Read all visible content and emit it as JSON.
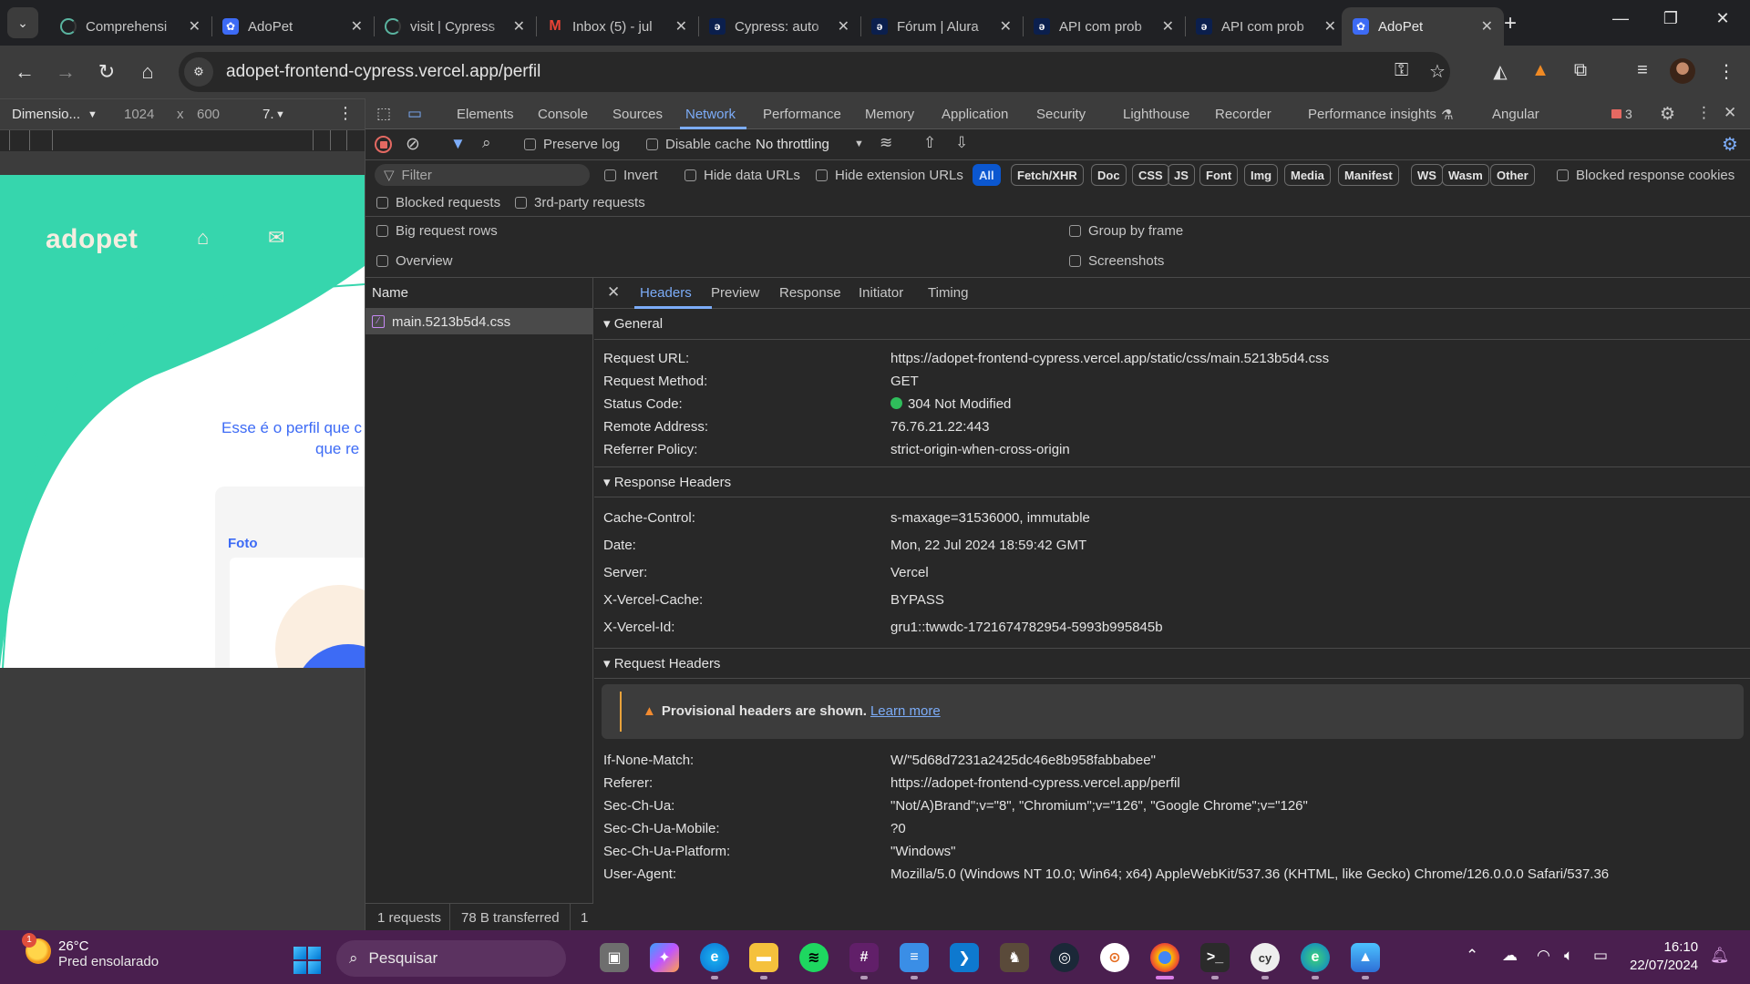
{
  "browser": {
    "tabs": [
      {
        "title": "Comprehensi",
        "favicon": "loading-spinner"
      },
      {
        "title": "AdoPet",
        "favicon": "adopet-paw"
      },
      {
        "title": "visit | Cypress",
        "favicon": "loading-spinner"
      },
      {
        "title": "Inbox (5) - jul",
        "favicon": "gmail"
      },
      {
        "title": "Cypress: auto",
        "favicon": "alura"
      },
      {
        "title": "Fórum | Alura",
        "favicon": "alura"
      },
      {
        "title": "API com prob",
        "favicon": "alura"
      },
      {
        "title": "API com prob",
        "favicon": "alura"
      },
      {
        "title": "AdoPet",
        "favicon": "adopet-paw",
        "active": true
      }
    ],
    "address": "adopet-frontend-cypress.vercel.app/perfil",
    "icons": {
      "back": "←",
      "forward": "→",
      "reload": "↻",
      "home": "⌂",
      "tab_menu": "⌄",
      "new_tab": "+",
      "close_tab": "✕",
      "minimize": "—",
      "restore": "❐",
      "close_window": "✕",
      "site_info": "⚙",
      "password_key": "⚿",
      "bookmark": "☆",
      "extensions": "⧉",
      "media": "≡",
      "menu": "⋮"
    }
  },
  "device_toolbar": {
    "dimensions_label": "Dimensio...",
    "width": "1024",
    "times": "x",
    "height": "600",
    "zoom": "7.",
    "more": "⋮"
  },
  "page": {
    "logo": "adopet",
    "text_line1": "Esse é o perfil que c",
    "text_line2": "que re",
    "foto_label": "Foto",
    "colors": {
      "brand_green": "#36d6ad",
      "brand_blue": "#3d6bf5",
      "cream": "#f5ede0"
    }
  },
  "devtools": {
    "tabs": [
      "Elements",
      "Console",
      "Sources",
      "Network",
      "Performance",
      "Memory",
      "Application",
      "Security",
      "Lighthouse",
      "Recorder",
      "Performance insights",
      "Angular"
    ],
    "active_tab": "Network",
    "issues_count": "3",
    "network_toolbar": {
      "preserve_log": "Preserve log",
      "disable_cache": "Disable cache",
      "throttling": "No throttling"
    },
    "filter": {
      "placeholder": "Filter",
      "invert": "Invert",
      "hide_data_urls": "Hide data URLs",
      "hide_extension_urls": "Hide extension URLs",
      "types": [
        "All",
        "Fetch/XHR",
        "Doc",
        "CSS",
        "JS",
        "Font",
        "Img",
        "Media",
        "Manifest",
        "WS",
        "Wasm",
        "Other"
      ],
      "active_type": "All",
      "blocked_response_cookies": "Blocked response cookies",
      "blocked_requests": "Blocked requests",
      "third_party": "3rd-party requests"
    },
    "settings": {
      "big_request_rows": "Big request rows",
      "overview": "Overview",
      "group_by_frame": "Group by frame",
      "screenshots": "Screenshots"
    },
    "requests": {
      "column": "Name",
      "rows": [
        {
          "name": "main.5213b5d4.css",
          "type": "css"
        }
      ],
      "status_requests": "1 requests",
      "status_transferred": "78 B transferred",
      "status_extra": "1"
    },
    "details": {
      "tabs": [
        "Headers",
        "Preview",
        "Response",
        "Initiator",
        "Timing"
      ],
      "active_tab": "Headers",
      "general": {
        "title": "General",
        "rows": [
          {
            "k": "Request URL:",
            "v": "https://adopet-frontend-cypress.vercel.app/static/css/main.5213b5d4.css"
          },
          {
            "k": "Request Method:",
            "v": "GET"
          },
          {
            "k": "Status Code:",
            "v": "304 Not Modified"
          },
          {
            "k": "Remote Address:",
            "v": "76.76.21.22:443"
          },
          {
            "k": "Referrer Policy:",
            "v": "strict-origin-when-cross-origin"
          }
        ]
      },
      "response_headers": {
        "title": "Response Headers",
        "rows": [
          {
            "k": "Cache-Control:",
            "v": "s-maxage=31536000, immutable"
          },
          {
            "k": "Date:",
            "v": "Mon, 22 Jul 2024 18:59:42 GMT"
          },
          {
            "k": "Server:",
            "v": "Vercel"
          },
          {
            "k": "X-Vercel-Cache:",
            "v": "BYPASS"
          },
          {
            "k": "X-Vercel-Id:",
            "v": "gru1::twwdc-1721674782954-5993b995845b"
          }
        ]
      },
      "request_headers": {
        "title": "Request Headers",
        "warning": "Provisional headers are shown.",
        "learn_more": "Learn more",
        "rows": [
          {
            "k": "If-None-Match:",
            "v": "W/\"5d68d7231a2425dc46e8b958fabbabee\""
          },
          {
            "k": "Referer:",
            "v": "https://adopet-frontend-cypress.vercel.app/perfil"
          },
          {
            "k": "Sec-Ch-Ua:",
            "v": "\"Not/A)Brand\";v=\"8\", \"Chromium\";v=\"126\", \"Google Chrome\";v=\"126\""
          },
          {
            "k": "Sec-Ch-Ua-Mobile:",
            "v": "?0"
          },
          {
            "k": "Sec-Ch-Ua-Platform:",
            "v": "\"Windows\""
          },
          {
            "k": "User-Agent:",
            "v": "Mozilla/5.0 (Windows NT 10.0; Win64; x64) AppleWebKit/537.36 (KHTML, like Gecko) Chrome/126.0.0.0 Safari/537.36"
          }
        ]
      },
      "status_color": "#2fbd5b"
    }
  },
  "taskbar": {
    "weather_temp": "26°C",
    "weather_desc": "Pred ensolarado",
    "weather_badge": "1",
    "search_placeholder": "Pesquisar",
    "time": "16:10",
    "date": "22/07/2024",
    "apps": [
      "Task View",
      "Copilot",
      "Edge",
      "File Explorer",
      "Spotify",
      "Slack",
      "Notepad",
      "VS Code",
      "Game",
      "Steam",
      "OpenVPN",
      "Chrome",
      "Terminal",
      "Cypress",
      "Edge Dev",
      "Photos"
    ]
  }
}
